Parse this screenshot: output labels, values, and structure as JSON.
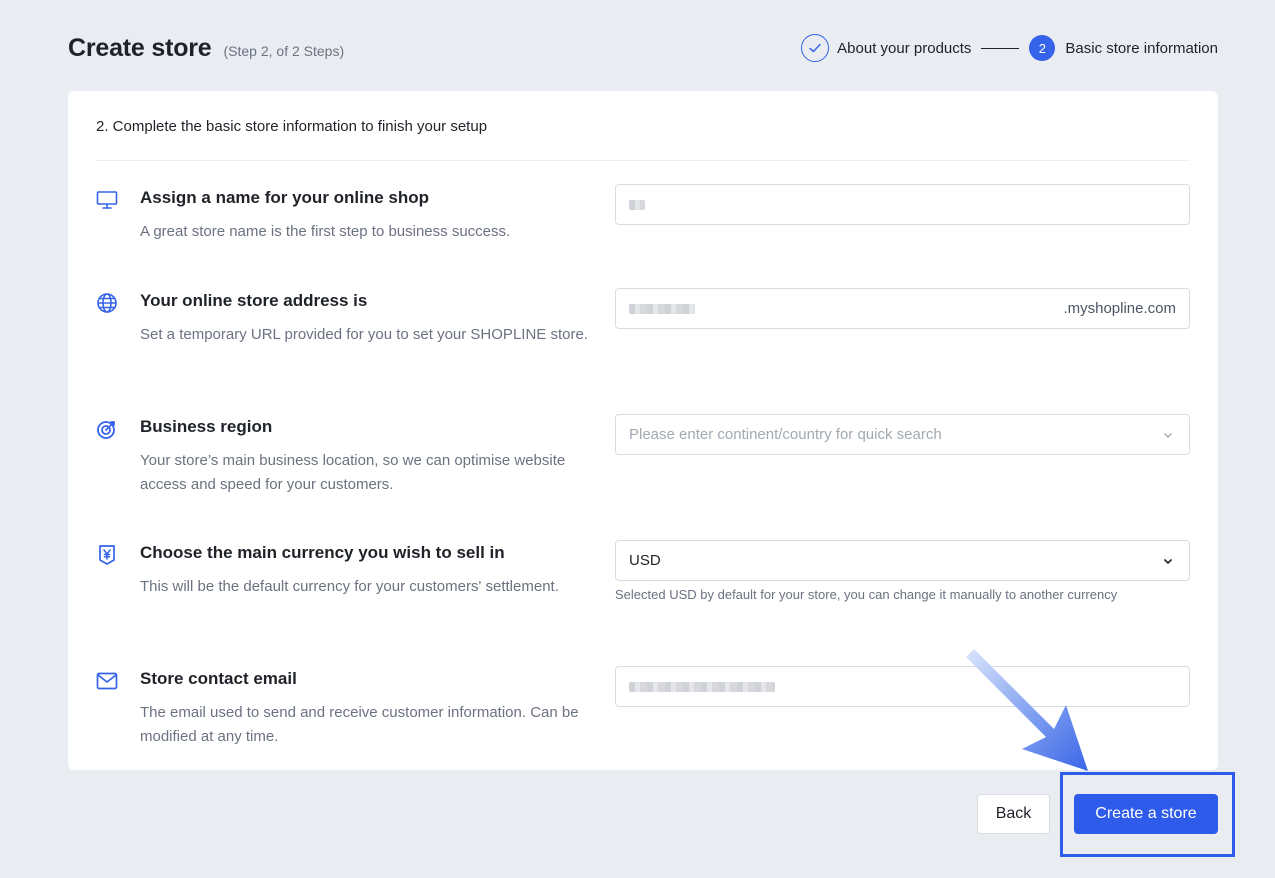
{
  "header": {
    "title": "Create store",
    "subtitle": "(Step 2, of 2 Steps)"
  },
  "steps": [
    {
      "label": "About your products",
      "status": "done"
    },
    {
      "number": "2",
      "label": "Basic store information",
      "status": "active"
    }
  ],
  "card": {
    "intro": "2. Complete the basic store information to finish your setup",
    "sections": {
      "name": {
        "icon": "monitor-icon",
        "title": "Assign a name for your online shop",
        "description": "A great store name is the first step to business success."
      },
      "address": {
        "icon": "globe-icon",
        "title": "Your online store address is",
        "description": "Set a temporary URL provided for you to set your SHOPLINE store.",
        "suffix": ".myshopline.com"
      },
      "region": {
        "icon": "target-icon",
        "title": "Business region",
        "description": "Your store’s main business location, so we can optimise website access and speed for your customers.",
        "placeholder": "Please enter continent/country for quick search"
      },
      "currency": {
        "icon": "currency-icon",
        "title": "Choose the main currency you wish to sell in",
        "description": "This will be the default currency for your customers' settlement.",
        "value": "USD",
        "hint": "Selected USD by default for your store, you can change it manually to another currency"
      },
      "email": {
        "icon": "mail-icon",
        "title": "Store contact email",
        "description": "The email used to send and receive customer information. Can be modified at any time."
      }
    }
  },
  "footer": {
    "back_label": "Back",
    "create_label": "Create a store"
  },
  "colors": {
    "accent": "#2f5bea",
    "background": "#e9ecf1"
  }
}
